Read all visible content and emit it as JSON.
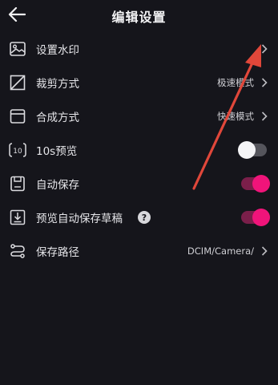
{
  "header": {
    "title": "编辑设置"
  },
  "settings": {
    "watermark": {
      "label": "设置水印"
    },
    "crop": {
      "label": "裁剪方式",
      "value": "极速模式"
    },
    "compose": {
      "label": "合成方式",
      "value": "快速模式"
    },
    "preview10s": {
      "label": "10s预览",
      "enabled": false
    },
    "autosave": {
      "label": "自动保存",
      "enabled": true
    },
    "preview_autosave_draft": {
      "label": "预览自动保存草稿",
      "help": "?",
      "enabled": true
    },
    "save_path": {
      "label": "保存路径",
      "value": "DCIM/Camera/"
    }
  },
  "colors": {
    "accent": "#f0147a",
    "background": "#15151b",
    "annotation_arrow": "#e0473a"
  },
  "icons": [
    "back-arrow-icon",
    "image-icon",
    "crop-icon",
    "window-icon",
    "timer-10-icon",
    "save-icon",
    "download-icon",
    "path-icon",
    "chevron-right-icon"
  ]
}
